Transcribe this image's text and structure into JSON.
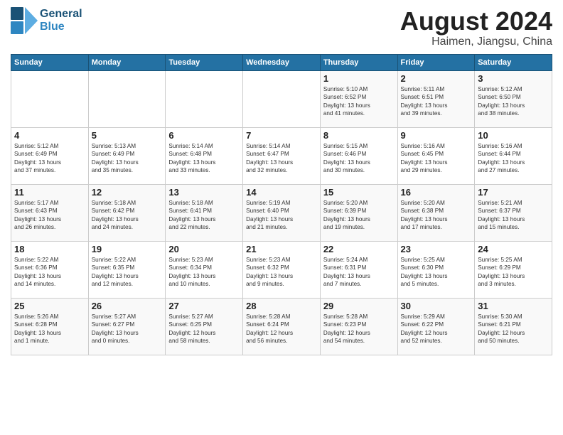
{
  "logo": {
    "line1": "General",
    "line2": "Blue"
  },
  "title": {
    "month_year": "August 2024",
    "location": "Haimen, Jiangsu, China"
  },
  "days_of_week": [
    "Sunday",
    "Monday",
    "Tuesday",
    "Wednesday",
    "Thursday",
    "Friday",
    "Saturday"
  ],
  "weeks": [
    [
      {
        "day": "",
        "info": ""
      },
      {
        "day": "",
        "info": ""
      },
      {
        "day": "",
        "info": ""
      },
      {
        "day": "",
        "info": ""
      },
      {
        "day": "1",
        "info": "Sunrise: 5:10 AM\nSunset: 6:52 PM\nDaylight: 13 hours\nand 41 minutes."
      },
      {
        "day": "2",
        "info": "Sunrise: 5:11 AM\nSunset: 6:51 PM\nDaylight: 13 hours\nand 39 minutes."
      },
      {
        "day": "3",
        "info": "Sunrise: 5:12 AM\nSunset: 6:50 PM\nDaylight: 13 hours\nand 38 minutes."
      }
    ],
    [
      {
        "day": "4",
        "info": "Sunrise: 5:12 AM\nSunset: 6:49 PM\nDaylight: 13 hours\nand 37 minutes."
      },
      {
        "day": "5",
        "info": "Sunrise: 5:13 AM\nSunset: 6:49 PM\nDaylight: 13 hours\nand 35 minutes."
      },
      {
        "day": "6",
        "info": "Sunrise: 5:14 AM\nSunset: 6:48 PM\nDaylight: 13 hours\nand 33 minutes."
      },
      {
        "day": "7",
        "info": "Sunrise: 5:14 AM\nSunset: 6:47 PM\nDaylight: 13 hours\nand 32 minutes."
      },
      {
        "day": "8",
        "info": "Sunrise: 5:15 AM\nSunset: 6:46 PM\nDaylight: 13 hours\nand 30 minutes."
      },
      {
        "day": "9",
        "info": "Sunrise: 5:16 AM\nSunset: 6:45 PM\nDaylight: 13 hours\nand 29 minutes."
      },
      {
        "day": "10",
        "info": "Sunrise: 5:16 AM\nSunset: 6:44 PM\nDaylight: 13 hours\nand 27 minutes."
      }
    ],
    [
      {
        "day": "11",
        "info": "Sunrise: 5:17 AM\nSunset: 6:43 PM\nDaylight: 13 hours\nand 26 minutes."
      },
      {
        "day": "12",
        "info": "Sunrise: 5:18 AM\nSunset: 6:42 PM\nDaylight: 13 hours\nand 24 minutes."
      },
      {
        "day": "13",
        "info": "Sunrise: 5:18 AM\nSunset: 6:41 PM\nDaylight: 13 hours\nand 22 minutes."
      },
      {
        "day": "14",
        "info": "Sunrise: 5:19 AM\nSunset: 6:40 PM\nDaylight: 13 hours\nand 21 minutes."
      },
      {
        "day": "15",
        "info": "Sunrise: 5:20 AM\nSunset: 6:39 PM\nDaylight: 13 hours\nand 19 minutes."
      },
      {
        "day": "16",
        "info": "Sunrise: 5:20 AM\nSunset: 6:38 PM\nDaylight: 13 hours\nand 17 minutes."
      },
      {
        "day": "17",
        "info": "Sunrise: 5:21 AM\nSunset: 6:37 PM\nDaylight: 13 hours\nand 15 minutes."
      }
    ],
    [
      {
        "day": "18",
        "info": "Sunrise: 5:22 AM\nSunset: 6:36 PM\nDaylight: 13 hours\nand 14 minutes."
      },
      {
        "day": "19",
        "info": "Sunrise: 5:22 AM\nSunset: 6:35 PM\nDaylight: 13 hours\nand 12 minutes."
      },
      {
        "day": "20",
        "info": "Sunrise: 5:23 AM\nSunset: 6:34 PM\nDaylight: 13 hours\nand 10 minutes."
      },
      {
        "day": "21",
        "info": "Sunrise: 5:23 AM\nSunset: 6:32 PM\nDaylight: 13 hours\nand 9 minutes."
      },
      {
        "day": "22",
        "info": "Sunrise: 5:24 AM\nSunset: 6:31 PM\nDaylight: 13 hours\nand 7 minutes."
      },
      {
        "day": "23",
        "info": "Sunrise: 5:25 AM\nSunset: 6:30 PM\nDaylight: 13 hours\nand 5 minutes."
      },
      {
        "day": "24",
        "info": "Sunrise: 5:25 AM\nSunset: 6:29 PM\nDaylight: 13 hours\nand 3 minutes."
      }
    ],
    [
      {
        "day": "25",
        "info": "Sunrise: 5:26 AM\nSunset: 6:28 PM\nDaylight: 13 hours\nand 1 minute."
      },
      {
        "day": "26",
        "info": "Sunrise: 5:27 AM\nSunset: 6:27 PM\nDaylight: 13 hours\nand 0 minutes."
      },
      {
        "day": "27",
        "info": "Sunrise: 5:27 AM\nSunset: 6:25 PM\nDaylight: 12 hours\nand 58 minutes."
      },
      {
        "day": "28",
        "info": "Sunrise: 5:28 AM\nSunset: 6:24 PM\nDaylight: 12 hours\nand 56 minutes."
      },
      {
        "day": "29",
        "info": "Sunrise: 5:28 AM\nSunset: 6:23 PM\nDaylight: 12 hours\nand 54 minutes."
      },
      {
        "day": "30",
        "info": "Sunrise: 5:29 AM\nSunset: 6:22 PM\nDaylight: 12 hours\nand 52 minutes."
      },
      {
        "day": "31",
        "info": "Sunrise: 5:30 AM\nSunset: 6:21 PM\nDaylight: 12 hours\nand 50 minutes."
      }
    ]
  ]
}
